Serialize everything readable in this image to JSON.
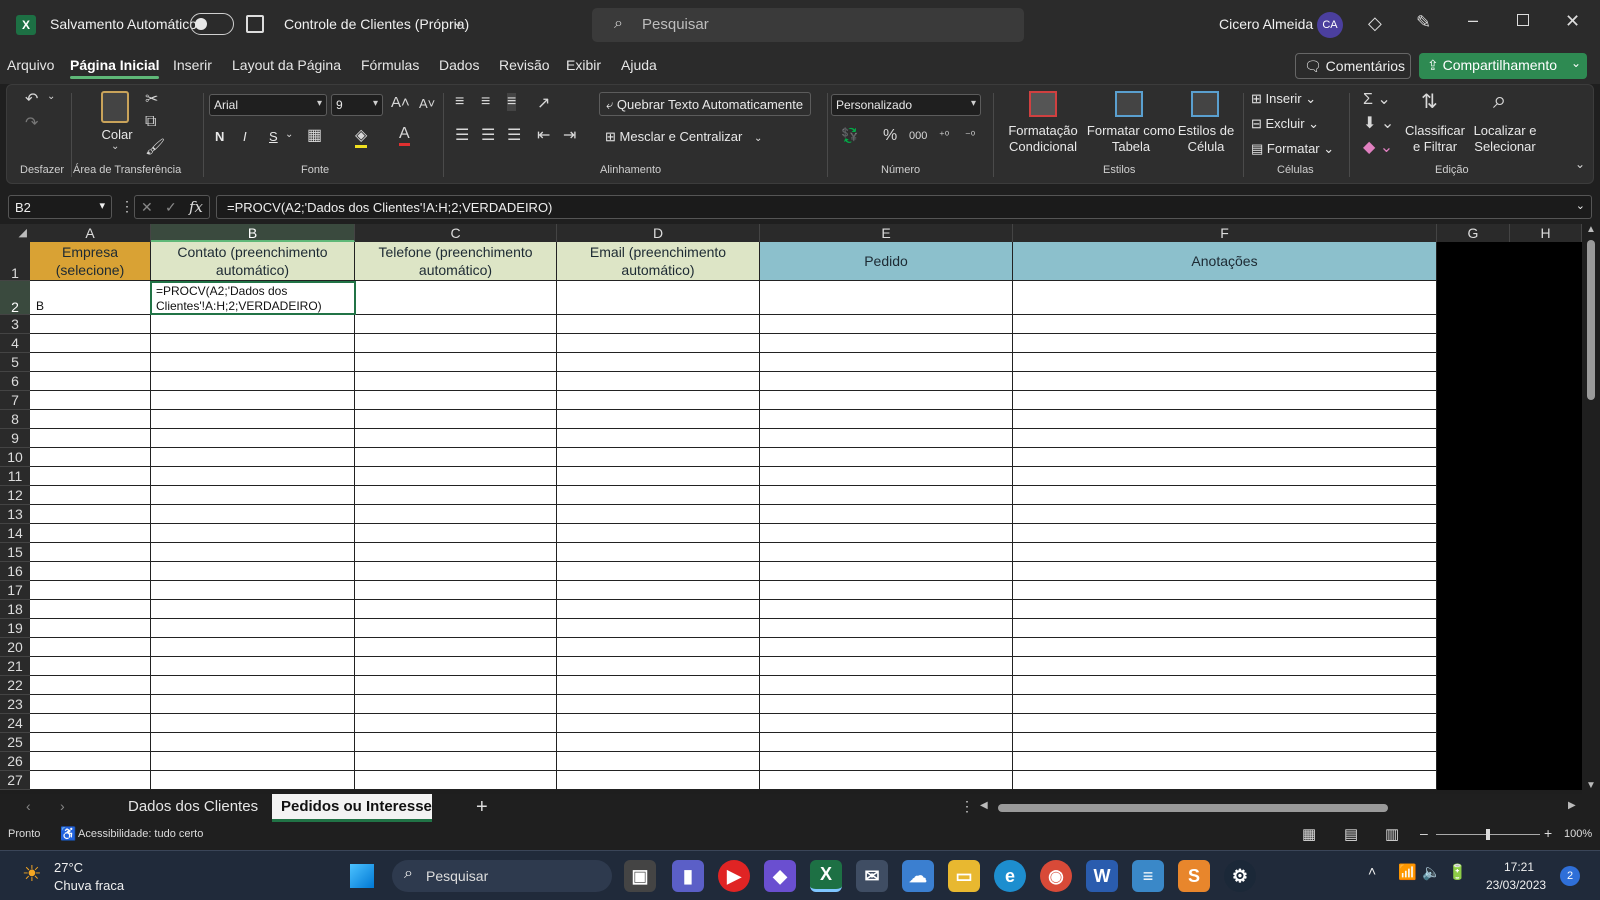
{
  "titlebar": {
    "autosave_label": "Salvamento Automático",
    "doc_title": "Controle de Clientes (Própria)",
    "search_placeholder": "Pesquisar",
    "user_name": "Cicero Almeida",
    "user_initials": "CA"
  },
  "menu": {
    "items": [
      "Arquivo",
      "Página Inicial",
      "Inserir",
      "Layout da Página",
      "Fórmulas",
      "Dados",
      "Revisão",
      "Exibir",
      "Ajuda"
    ],
    "active": "Página Inicial",
    "comments": "Comentários",
    "share": "Compartilhamento"
  },
  "ribbon": {
    "undo_group": "Desfazer",
    "paste": "Colar",
    "clipboard_group": "Área de Transferência",
    "font_name": "Arial",
    "font_size": "9",
    "bold": "N",
    "italic": "I",
    "underline": "S",
    "font_group": "Fonte",
    "wrap_text": "Quebrar Texto Automaticamente",
    "merge_center": "Mesclar e Centralizar",
    "alignment_group": "Alinhamento",
    "number_format": "Personalizado",
    "number_group": "Número",
    "cond_format_1": "Formatação",
    "cond_format_2": "Condicional",
    "format_table_1": "Formatar como",
    "format_table_2": "Tabela",
    "cell_styles_1": "Estilos de",
    "cell_styles_2": "Célula",
    "styles_group": "Estilos",
    "insert": "Inserir",
    "delete": "Excluir",
    "format": "Formatar",
    "cells_group": "Células",
    "sort_1": "Classificar",
    "sort_2": "e Filtrar",
    "find_1": "Localizar e",
    "find_2": "Selecionar",
    "editing_group": "Edição"
  },
  "formula_bar": {
    "name_box": "B2",
    "formula": "=PROCV(A2;'Dados dos Clientes'!A:H;2;VERDADEIRO)"
  },
  "grid": {
    "columns": [
      "A",
      "B",
      "C",
      "D",
      "E",
      "F",
      "G",
      "H"
    ],
    "selected_column": "B",
    "rows": [
      "1",
      "2",
      "3",
      "4",
      "5",
      "6",
      "7",
      "8",
      "9",
      "10",
      "11",
      "12",
      "13",
      "14",
      "15",
      "16",
      "17",
      "18",
      "19",
      "20",
      "21",
      "22",
      "23",
      "24",
      "25",
      "26",
      "27"
    ],
    "headers": {
      "a": "Empresa (selecione)",
      "b": "Contato (preenchimento automático)",
      "c": "Telefone (preenchimento automático)",
      "d": "Email (preenchimento automático)",
      "e": "Pedido",
      "f": "Anotações"
    },
    "a2": "B",
    "b2": "=PROCV(A2;'Dados dos Clientes'!A:H;2;VERDADEIRO)",
    "colors": {
      "a_header": "#d9a234",
      "bcd_header": "#dde5c6",
      "ef_header": "#8cc0cc"
    }
  },
  "sheets": {
    "tabs": [
      "Dados dos Clientes",
      "Pedidos ou Interesse"
    ],
    "active": "Pedidos ou Interesse"
  },
  "status": {
    "ready": "Pronto",
    "accessibility": "Acessibilidade: tudo certo",
    "zoom": "100%"
  },
  "taskbar": {
    "temperature": "27°C",
    "weather": "Chuva fraca",
    "search": "Pesquisar",
    "time": "17:21",
    "date": "23/03/2023",
    "notifications": "2"
  }
}
